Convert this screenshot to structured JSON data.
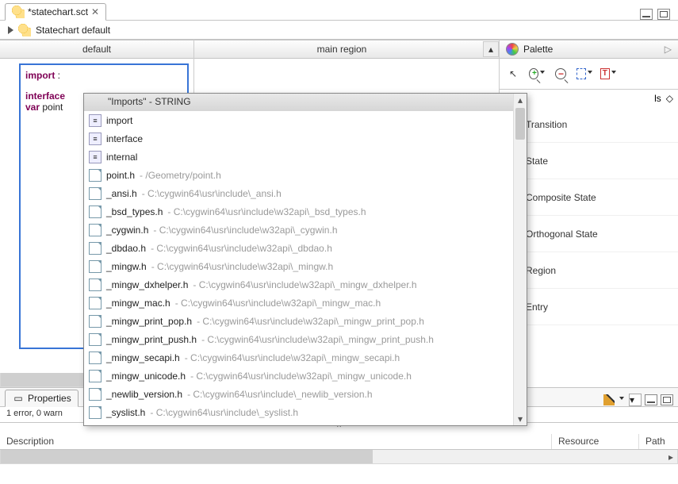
{
  "tab": {
    "title": "*statechart.sct"
  },
  "breadcrumb": {
    "label": "Statechart default"
  },
  "columns": {
    "left": "default",
    "center": "main region"
  },
  "editor": {
    "line1_kw": "import",
    "line1_rest": " :",
    "line2_kw": "interface",
    "line2_rest": "",
    "line3_kw": "var",
    "line3_rest": " point"
  },
  "palette": {
    "title": "Palette",
    "sections": {
      "tools": "ls"
    },
    "items": [
      "Transition",
      "State",
      "Composite State",
      "Orthogonal State",
      "Region",
      "Entry"
    ]
  },
  "autocomplete": {
    "header": "\"Imports\" - STRING",
    "keywords": [
      "import",
      "interface",
      "internal"
    ],
    "files": [
      {
        "name": "point.h",
        "path": "/Geometry/point.h"
      },
      {
        "name": "_ansi.h",
        "path": "C:\\cygwin64\\usr\\include\\_ansi.h"
      },
      {
        "name": "_bsd_types.h",
        "path": "C:\\cygwin64\\usr\\include\\w32api\\_bsd_types.h"
      },
      {
        "name": "_cygwin.h",
        "path": "C:\\cygwin64\\usr\\include\\w32api\\_cygwin.h"
      },
      {
        "name": "_dbdao.h",
        "path": "C:\\cygwin64\\usr\\include\\w32api\\_dbdao.h"
      },
      {
        "name": "_mingw.h",
        "path": "C:\\cygwin64\\usr\\include\\w32api\\_mingw.h"
      },
      {
        "name": "_mingw_dxhelper.h",
        "path": "C:\\cygwin64\\usr\\include\\w32api\\_mingw_dxhelper.h"
      },
      {
        "name": "_mingw_mac.h",
        "path": "C:\\cygwin64\\usr\\include\\w32api\\_mingw_mac.h"
      },
      {
        "name": "_mingw_print_pop.h",
        "path": "C:\\cygwin64\\usr\\include\\w32api\\_mingw_print_pop.h"
      },
      {
        "name": "_mingw_print_push.h",
        "path": "C:\\cygwin64\\usr\\include\\w32api\\_mingw_print_push.h"
      },
      {
        "name": "_mingw_secapi.h",
        "path": "C:\\cygwin64\\usr\\include\\w32api\\_mingw_secapi.h"
      },
      {
        "name": "_mingw_unicode.h",
        "path": "C:\\cygwin64\\usr\\include\\w32api\\_mingw_unicode.h"
      },
      {
        "name": "_newlib_version.h",
        "path": "C:\\cygwin64\\usr\\include\\_newlib_version.h"
      },
      {
        "name": "_syslist.h",
        "path": "C:\\cygwin64\\usr\\include\\_syslist.h"
      }
    ]
  },
  "problems": {
    "tab": "Properties",
    "status": "1 error, 0 warn",
    "columns": {
      "desc": "Description",
      "res": "Resource",
      "path": "Path"
    }
  }
}
